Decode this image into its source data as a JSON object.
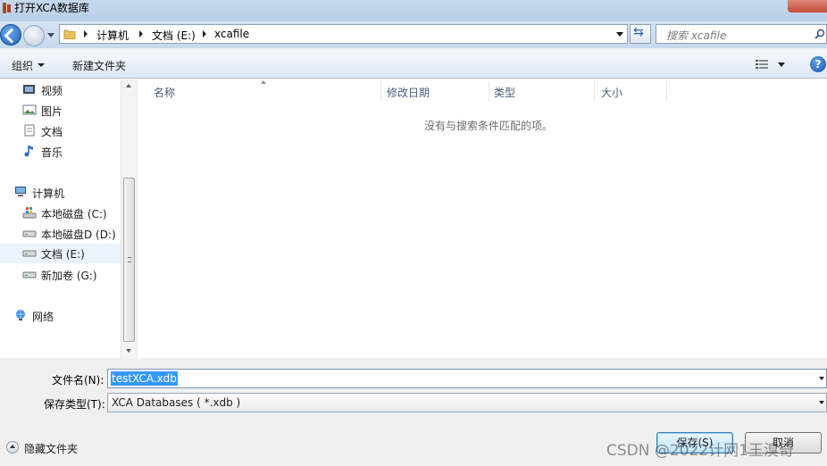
{
  "window": {
    "title": "打开XCA数据库"
  },
  "address": {
    "crumbs": [
      "计算机",
      "文档 (E:)",
      "xcafile"
    ]
  },
  "search": {
    "placeholder": "搜索 xcafile"
  },
  "toolbar": {
    "organize": "组织",
    "new_folder": "新建文件夹"
  },
  "nav": {
    "items": [
      {
        "label": "视频",
        "icon": "video-library-icon"
      },
      {
        "label": "图片",
        "icon": "pictures-library-icon"
      },
      {
        "label": "文档",
        "icon": "documents-library-icon"
      },
      {
        "label": "音乐",
        "icon": "music-library-icon"
      },
      {
        "label": "计算机",
        "icon": "computer-icon"
      },
      {
        "label": "本地磁盘 (C:)",
        "icon": "system-drive-icon"
      },
      {
        "label": "本地磁盘D (D:)",
        "icon": "drive-icon"
      },
      {
        "label": "文档 (E:)",
        "icon": "drive-icon",
        "selected": true
      },
      {
        "label": "新加卷 (G:)",
        "icon": "drive-icon"
      },
      {
        "label": "网络",
        "icon": "network-icon"
      }
    ]
  },
  "filelist": {
    "columns": [
      "名称",
      "修改日期",
      "类型",
      "大小"
    ],
    "empty_message": "没有与搜索条件匹配的项。"
  },
  "form": {
    "filename_label": "文件名(N):",
    "filename_value": "testXCA.xdb",
    "filetype_label": "保存类型(T):",
    "filetype_value": "XCA Databases ( *.xdb )",
    "hide_folders": "隐藏文件夹",
    "save_button": "保存(S)",
    "cancel_button": "取消"
  },
  "watermark": "CSDN @2022计网1王溴奇",
  "colors": {
    "selection": "#3399ff",
    "titlebar": "#c6d8ec"
  }
}
